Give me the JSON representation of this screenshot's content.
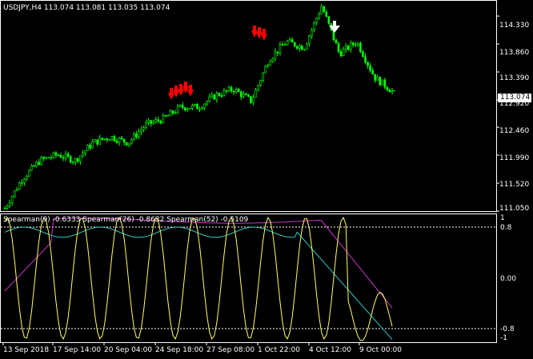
{
  "header": {
    "symbol": "USDJPY,H4",
    "ohlc": "113.074 113.081 113.035 113.074"
  },
  "indicator_header": {
    "s9": "Spearman(9) -0.6333",
    "s26": "Spearman(26) -0.8632",
    "s52": "Spearman(52) -0.5109"
  },
  "price_axis": [
    "114.330",
    "113.860",
    "113.390",
    "112.920",
    "112.460",
    "111.990",
    "111.520",
    "111.050"
  ],
  "current_price": "113.074",
  "indicator_axis": {
    "top": "1",
    "upper": "0.8",
    "mid": "0.00",
    "lower": "-0.8",
    "bottom": "-1"
  },
  "time_axis": [
    "13 Sep 2018",
    "17 Sep 14:00",
    "20 Sep 04:00",
    "24 Sep 18:00",
    "27 Sep 08:00",
    "1 Oct 22:00",
    "4 Oct 12:00",
    "9 Oct 00:00"
  ],
  "colors": {
    "background": "#000000",
    "candles": "#00ff00",
    "sell_signal": "#ff0000",
    "arrow": "#ffffff",
    "spearman9": "#ffff66",
    "spearman26": "#33cccc",
    "spearman52": "#cc33cc"
  },
  "chart_data": {
    "type": "line",
    "title": "USDJPY,H4",
    "price_range": [
      111.05,
      114.6
    ],
    "close_series_approx": [
      111.1,
      111.6,
      111.9,
      112.0,
      111.9,
      112.2,
      112.3,
      112.2,
      112.5,
      112.6,
      112.8,
      112.8,
      113.0,
      113.1,
      112.9,
      113.6,
      113.9,
      113.8,
      114.5,
      113.7,
      113.9,
      113.3,
      113.07
    ],
    "series": [
      {
        "name": "Spearman(9)",
        "last": -0.6333
      },
      {
        "name": "Spearman(26)",
        "last": -0.8632
      },
      {
        "name": "Spearman(52)",
        "last": -0.5109
      }
    ],
    "indicator_levels": [
      0.8,
      -0.8
    ]
  }
}
